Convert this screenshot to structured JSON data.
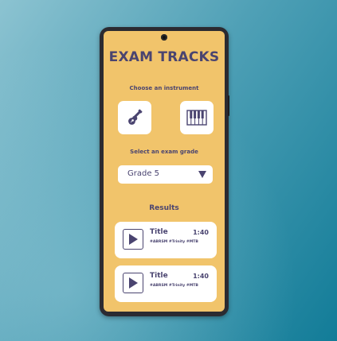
{
  "app": {
    "title": "EXAM TRACKS"
  },
  "instrument": {
    "label": "Choose an instrument",
    "options": [
      {
        "icon": "guitar-icon"
      },
      {
        "icon": "piano-icon"
      }
    ]
  },
  "grade": {
    "label": "Select an exam grade",
    "selected": "Grade 5"
  },
  "results": {
    "label": "Results",
    "items": [
      {
        "title": "Title",
        "duration": "1:40",
        "tags": "#ABRSM #Trinity #MTB"
      },
      {
        "title": "Title",
        "duration": "1:40",
        "tags": "#ABRSM #Trinity #MTB"
      }
    ]
  },
  "colors": {
    "screen_bg": "#f1c46b",
    "accent": "#4a4470",
    "card_bg": "#ffffff",
    "phone_frame": "#2b2b31"
  }
}
